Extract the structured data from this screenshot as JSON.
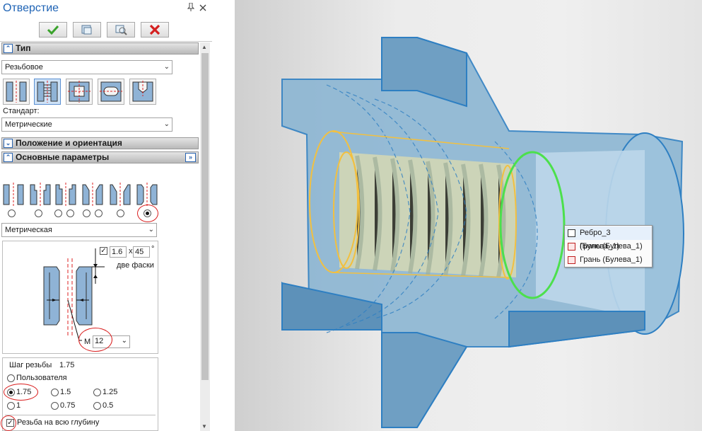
{
  "panel": {
    "title": "Отверстие",
    "pin_icon": "pin-icon",
    "close_icon": "close-icon",
    "toolbar": {
      "ok": "check-icon",
      "preview": "preview-icon",
      "preview_zoom": "preview-zoom-icon",
      "cancel": "cross-icon"
    },
    "sections": {
      "type": "Тип",
      "position": "Положение и ориентация",
      "main_params": "Основные параметры"
    },
    "hole_type_value": "Резьбовое",
    "standard_label": "Стандарт:",
    "standard_value": "Метрические",
    "thread_type_value": "Метрическая",
    "chamfer": {
      "length": "1.6",
      "x": "x",
      "angle": "45",
      "deg": "°",
      "label": "две фаски"
    },
    "diameter": {
      "prefix": "M",
      "value": "12"
    },
    "pitch": {
      "title": "Шаг резьбы",
      "value": "1.75",
      "options": [
        "Пользователя",
        "1.75",
        "1.5",
        "1.25",
        "1",
        "0.75",
        "0.5"
      ],
      "selected": "1.75"
    },
    "full_depth_label": "Резьба на всю глубину"
  },
  "context_menu": {
    "items": [
      "Ребро_3 (Булева_1)",
      "Грань (Булева_1)",
      "Грань (Булева_1)"
    ]
  },
  "colors": {
    "title_blue": "#1e63b5",
    "part_fill": "#8cb6d3",
    "edge_blue": "#2e7fc2",
    "edge_yellow": "#f2c040",
    "edge_green": "#4ce04c",
    "annotation_red": "#d91f1f"
  }
}
